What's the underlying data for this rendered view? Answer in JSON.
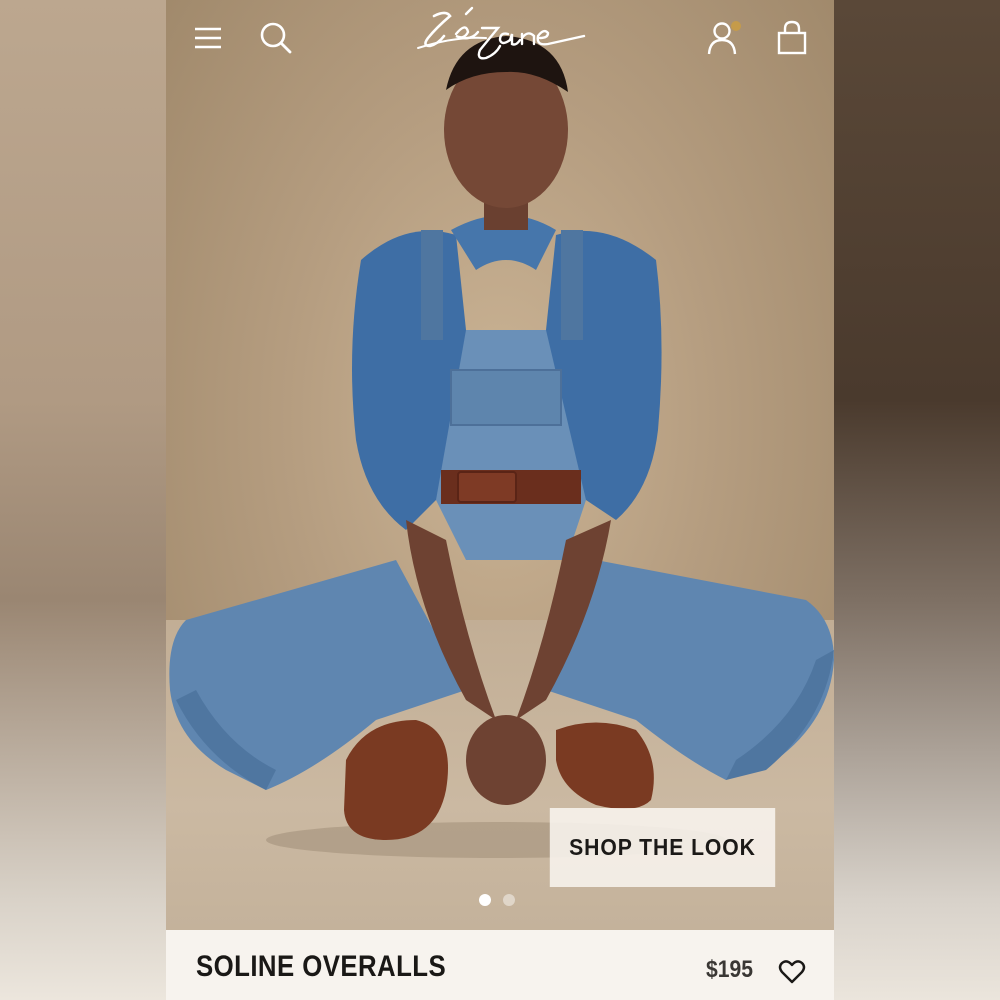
{
  "header": {
    "brand_logo": "Sézane",
    "menu_icon": "menu-icon",
    "search_icon": "search-icon",
    "account_icon": "account-icon",
    "bag_icon": "shopping-bag-icon",
    "notification_dot_color": "#c59b4a"
  },
  "hero": {
    "cta_label": "SHOP THE LOOK",
    "carousel": {
      "total_slides": 2,
      "active_slide": 1
    }
  },
  "product": {
    "name": "SOLINE OVERALLS",
    "price": "$195",
    "wishlist_icon": "heart-icon"
  },
  "colors": {
    "text_dark": "#1a1816",
    "cta_background": "#f8f4ee",
    "product_bar_background": "#f7f3ee"
  }
}
